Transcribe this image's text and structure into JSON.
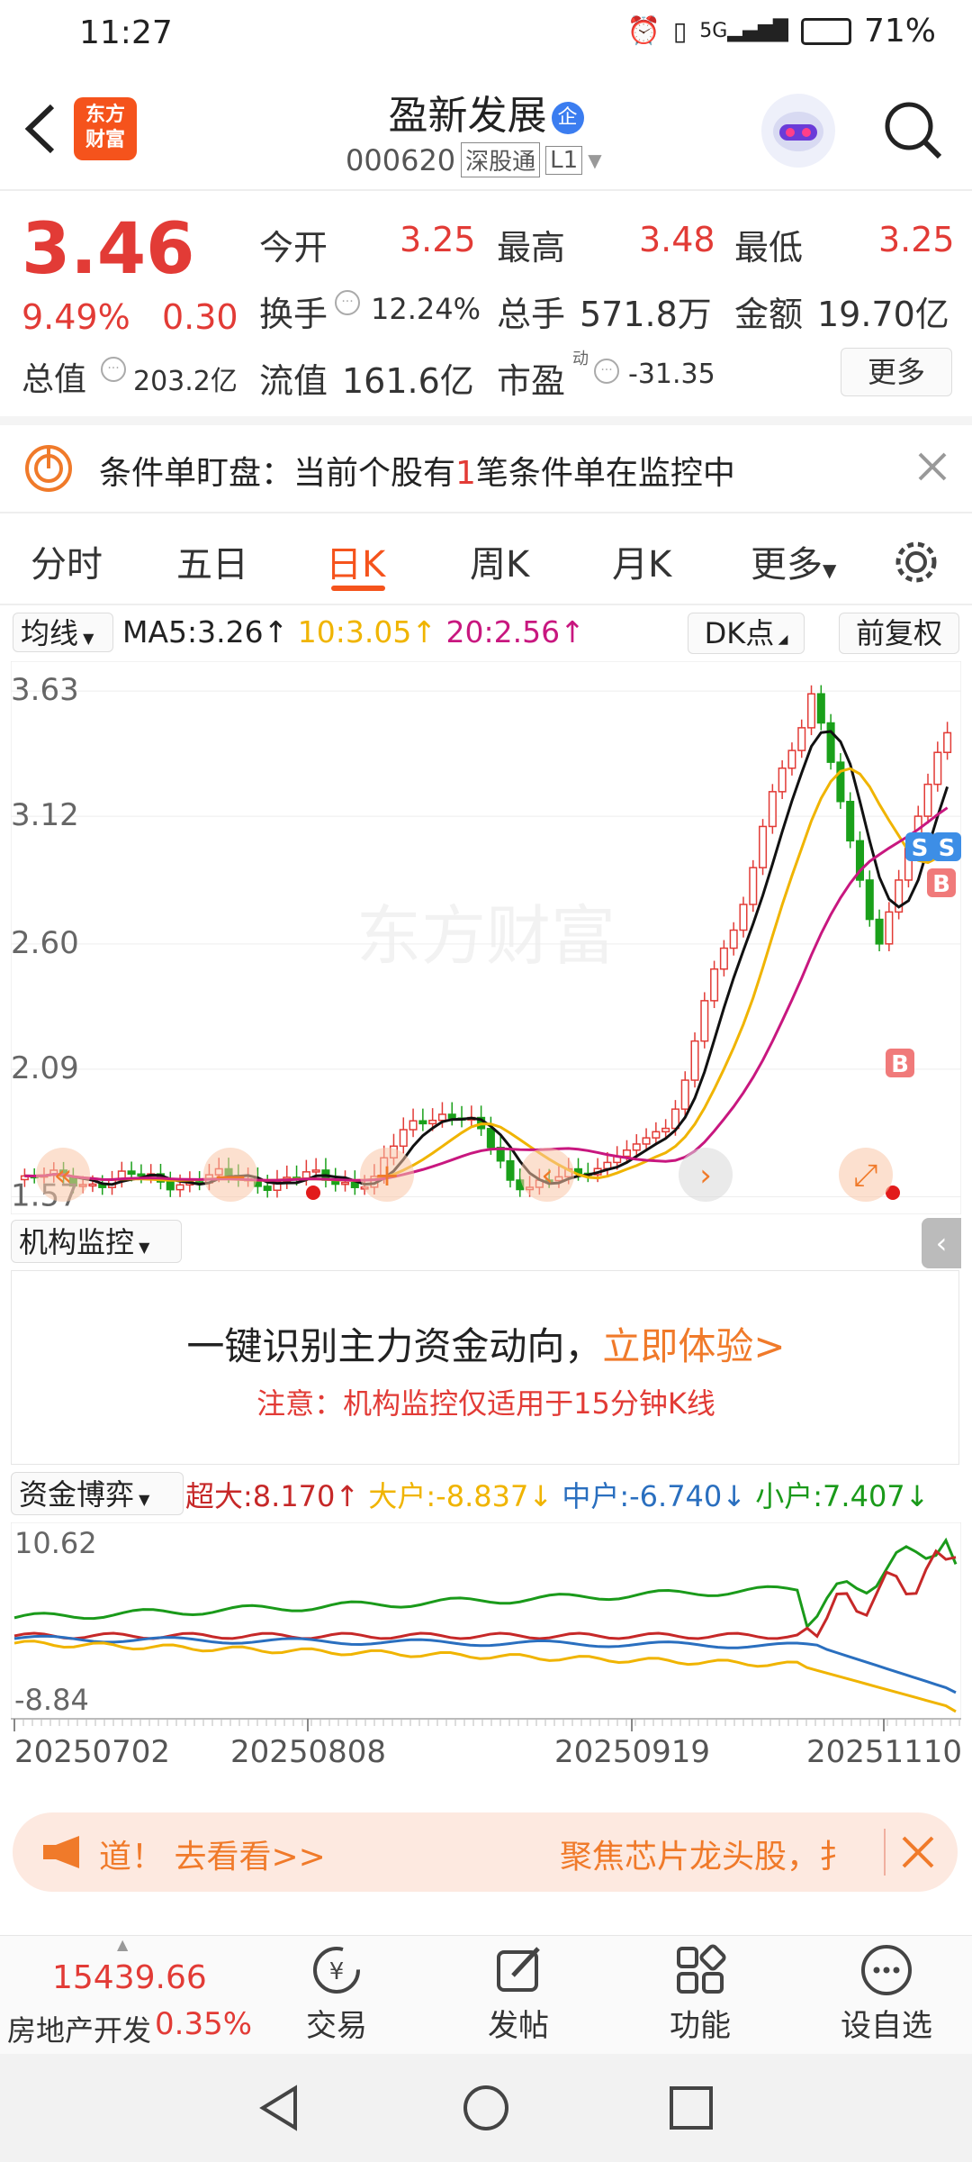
{
  "status_bar": {
    "time": "11:27",
    "network": "5G",
    "battery": "71%"
  },
  "header": {
    "logo_line1": "东方",
    "logo_line2": "财富",
    "title": "盈新发展",
    "title_badge": "企",
    "code": "000620",
    "market_tag": "深股通",
    "level_tag": "L1"
  },
  "quote": {
    "price": "3.46",
    "change_pct": "9.49%",
    "change": "0.30",
    "open_label": "今开",
    "open": "3.25",
    "high_label": "最高",
    "high": "3.48",
    "low_label": "最低",
    "low": "3.25",
    "turnover_label": "换手",
    "turnover": "12.24%",
    "volume_label": "总手",
    "volume": "571.8万",
    "amount_label": "金额",
    "amount": "19.70亿",
    "mktcap_label": "总值",
    "mktcap": "203.2亿",
    "float_label": "流值",
    "float": "161.6亿",
    "pe_label": "市盈",
    "pe_sup": "动",
    "pe": "-31.35",
    "more_label": "更多"
  },
  "condition_banner": {
    "prefix": "条件单盯盘：当前个股有",
    "count": "1",
    "suffix": "笔条件单在监控中"
  },
  "tabs": [
    "分时",
    "五日",
    "日K",
    "周K",
    "月K",
    "更多"
  ],
  "active_tab": "日K",
  "kline": {
    "ma_selector": "均线",
    "ma5": "MA5:3.26↑",
    "ma10": "10:3.05↑",
    "ma20": "20:2.56↑",
    "dk_button": "DK点",
    "adjust_button": "前复权",
    "y_ticks": [
      "3.63",
      "3.12",
      "2.60",
      "2.09",
      "1.57"
    ],
    "watermark": "东方财富",
    "marker_sell": "S",
    "marker_buy": "B",
    "colors": {
      "up": "#e23b36",
      "down": "#1aa01a",
      "ma5": "#111111",
      "ma10": "#f0b400",
      "ma20": "#c8177f"
    }
  },
  "institution": {
    "selector": "机构监控",
    "headline": "一键识别主力资金动向，",
    "cta": "立即体验>",
    "note": "注意：机构监控仅适用于15分钟K线"
  },
  "capital": {
    "selector": "资金博弈",
    "super": "超大:8.170↑",
    "large": "大户:-8.837↓",
    "mid": "中户:-6.740↓",
    "small": "小户:7.407↓",
    "y_top": "10.62",
    "y_bottom": "-8.84",
    "x_labels": [
      "20250702",
      "20250808",
      "20250919",
      "20251110"
    ],
    "colors": {
      "super": "#c62828",
      "large": "#f0b400",
      "mid": "#2a6fbf",
      "small": "#1a9a1a"
    }
  },
  "ticker": {
    "left": "道！ 去看看>>",
    "right": "聚焦芯片龙头股，扌"
  },
  "bottom_nav": {
    "index_value": "15439.66",
    "index_name": "房地产开发",
    "index_change": "0.35%",
    "items": [
      "交易",
      "发帖",
      "功能",
      "设自选"
    ]
  }
}
